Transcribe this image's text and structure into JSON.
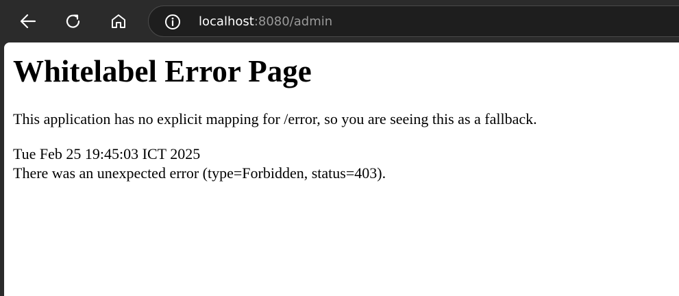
{
  "browser": {
    "nav": {
      "back_icon": "arrow-left-icon",
      "reload_icon": "reload-icon",
      "home_icon": "home-icon"
    },
    "omnibox": {
      "site_info_icon": "info-icon",
      "url_host": "localhost",
      "url_rest": ":8080/admin"
    },
    "colors": {
      "chrome_bg": "#2b2b2b",
      "omnibox_bg": "#1e1e1e",
      "url_host": "#ffffff",
      "url_rest": "#9a9a9a",
      "page_bg": "#ffffff"
    }
  },
  "page": {
    "title": "Whitelabel Error Page",
    "message": "This application has no explicit mapping for /error, so you are seeing this as a fallback.",
    "timestamp": "Tue Feb 25 19:45:03 ICT 2025",
    "error": "There was an unexpected error (type=Forbidden, status=403)."
  }
}
